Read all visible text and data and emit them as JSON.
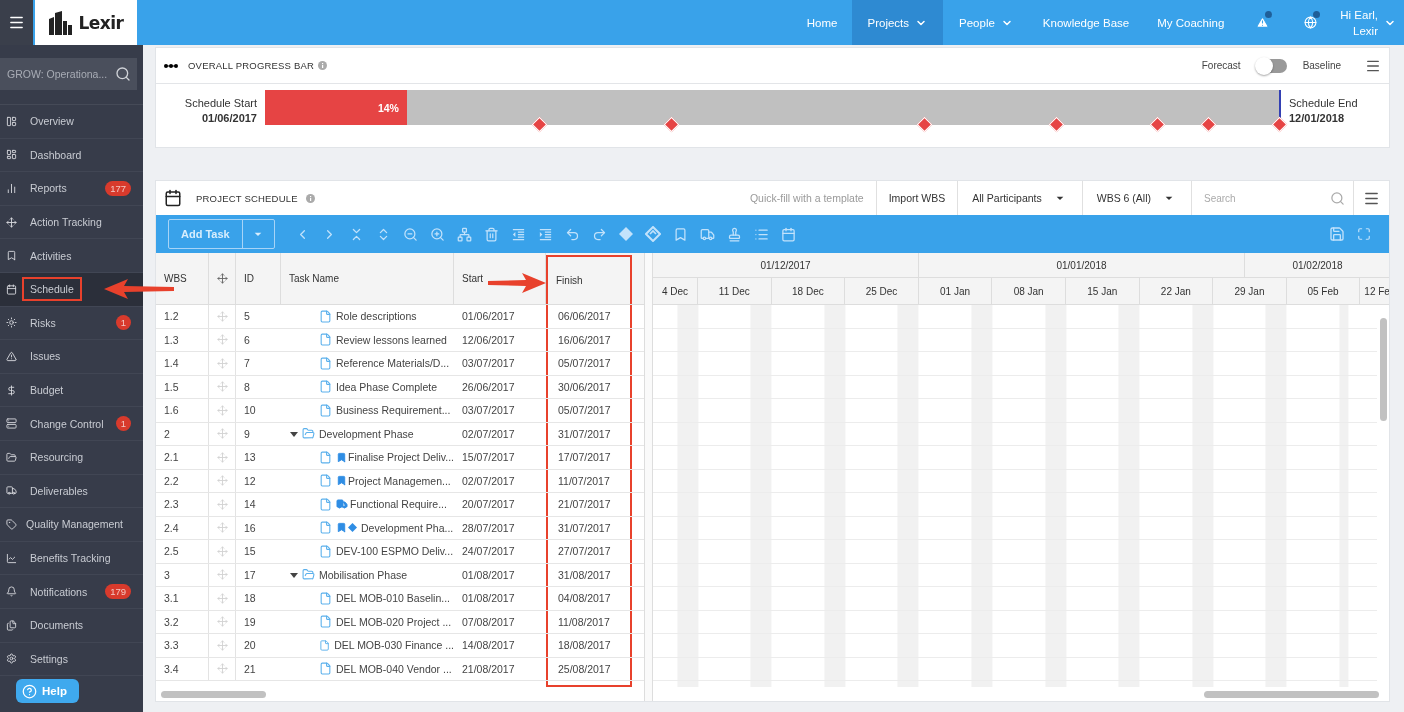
{
  "topbar": {
    "logo": "Lexir",
    "nav": [
      {
        "label": "Home",
        "selected": false,
        "dropdown": false
      },
      {
        "label": "Projects",
        "selected": true,
        "dropdown": true
      },
      {
        "label": "People",
        "selected": false,
        "dropdown": true
      },
      {
        "label": "Knowledge Base",
        "selected": false,
        "dropdown": false
      },
      {
        "label": "My Coaching",
        "selected": false,
        "dropdown": false
      }
    ],
    "alerts": [
      {
        "kind": "warning",
        "unread": true
      },
      {
        "kind": "globe",
        "unread": true
      }
    ],
    "user": {
      "greeting": "Hi Earl,",
      "org": "Lexir"
    }
  },
  "sidebar": {
    "project_search": {
      "value": "GROW: Operationa..."
    },
    "items": [
      {
        "label": "Overview",
        "selected": false,
        "highlighted": false
      },
      {
        "label": "Dashboard",
        "selected": false,
        "highlighted": false
      },
      {
        "label": "Reports",
        "badge": "177",
        "selected": false,
        "highlighted": false
      },
      {
        "label": "Action Tracking",
        "selected": false,
        "highlighted": false
      },
      {
        "label": "Activities",
        "selected": false,
        "highlighted": false
      },
      {
        "label": "Schedule",
        "selected": true,
        "highlighted": true
      },
      {
        "label": "Risks",
        "badge": "1",
        "selected": false,
        "highlighted": false
      },
      {
        "label": "Issues",
        "selected": false,
        "highlighted": false
      },
      {
        "label": "Budget",
        "selected": false,
        "highlighted": false
      },
      {
        "label": "Change Control",
        "badge": "1",
        "selected": false,
        "highlighted": false
      },
      {
        "label": "Resourcing",
        "selected": false,
        "highlighted": false
      },
      {
        "label": "Deliverables",
        "selected": false,
        "highlighted": false
      },
      {
        "label": "Quality Management",
        "selected": false,
        "highlighted": false
      },
      {
        "label": "Benefits Tracking",
        "selected": false,
        "highlighted": false
      },
      {
        "label": "Notifications",
        "badge": "179",
        "selected": false,
        "highlighted": false
      },
      {
        "label": "Documents",
        "selected": false,
        "highlighted": false
      },
      {
        "label": "Settings",
        "selected": false,
        "highlighted": false
      }
    ],
    "help": "Help"
  },
  "progress": {
    "title": "OVERALL PROGRESS BAR",
    "forecast_label": "Forecast",
    "baseline_label": "Baseline",
    "baseline_on": false,
    "start_label": "Schedule Start",
    "start_date": "01/06/2017",
    "end_label": "Schedule End",
    "end_date": "12/01/2018",
    "level": 0.14,
    "reading": "14%",
    "milestones": [
      {
        "level": 0.27
      },
      {
        "level": 0.4
      },
      {
        "level": 0.65
      },
      {
        "level": 0.78
      },
      {
        "level": 0.88
      },
      {
        "level": 0.93
      },
      {
        "level": 1.0
      }
    ]
  },
  "schedule": {
    "title": "PROJECT SCHEDULE",
    "quick_fill": "Quick-fill with a template",
    "import": "Import WBS",
    "participants": "All Participants",
    "wbs_filter": "WBS 6 (All)",
    "search": {
      "placeholder": "Search"
    },
    "add_task": "Add Task",
    "columns": [
      {
        "kind": "text",
        "label": "WBS",
        "highlighted": false
      },
      {
        "kind": "move",
        "highlighted": false
      },
      {
        "kind": "text",
        "label": "ID",
        "highlighted": false
      },
      {
        "kind": "text",
        "label": "Task Name",
        "highlighted": false
      },
      {
        "kind": "text",
        "label": "Start",
        "highlighted": false
      },
      {
        "kind": "text",
        "label": "Finish",
        "highlighted": true
      }
    ],
    "rows": [
      {
        "kind": "task",
        "wbs": "1.2",
        "id": "5",
        "name": "Role descriptions",
        "start": "01/06/2017",
        "finish": "06/06/2017",
        "bookmark": false,
        "truck": false,
        "milestone": false
      },
      {
        "kind": "task",
        "wbs": "1.3",
        "id": "6",
        "name": "Review lessons learned",
        "start": "12/06/2017",
        "finish": "16/06/2017",
        "bookmark": false,
        "truck": false,
        "milestone": false
      },
      {
        "kind": "task",
        "wbs": "1.4",
        "id": "7",
        "name": "Reference Materials/D...",
        "start": "03/07/2017",
        "finish": "05/07/2017",
        "bookmark": false,
        "truck": false,
        "milestone": false
      },
      {
        "kind": "task",
        "wbs": "1.5",
        "id": "8",
        "name": "Idea Phase Complete",
        "start": "26/06/2017",
        "finish": "30/06/2017",
        "bookmark": false,
        "truck": false,
        "milestone": false
      },
      {
        "kind": "task",
        "wbs": "1.6",
        "id": "10",
        "name": "Business Requirement...",
        "start": "03/07/2017",
        "finish": "05/07/2017",
        "bookmark": false,
        "truck": false,
        "milestone": false
      },
      {
        "kind": "phase",
        "wbs": "2",
        "id": "9",
        "name": "Development Phase",
        "start": "02/07/2017",
        "finish": "31/07/2017",
        "expanded": true,
        "children": [
          {
            "kind": "task",
            "wbs": "2.1",
            "id": "13",
            "name": "Finalise Project Deliv...",
            "start": "15/07/2017",
            "finish": "17/07/2017",
            "bookmark": true,
            "truck": false,
            "milestone": false
          },
          {
            "kind": "task",
            "wbs": "2.2",
            "id": "12",
            "name": "Project Managemen...",
            "start": "02/07/2017",
            "finish": "11/07/2017",
            "bookmark": true,
            "truck": false,
            "milestone": false
          },
          {
            "kind": "task",
            "wbs": "2.3",
            "id": "14",
            "name": "Functional Require...",
            "start": "20/07/2017",
            "finish": "21/07/2017",
            "bookmark": false,
            "truck": true,
            "milestone": false
          },
          {
            "kind": "task",
            "wbs": "2.4",
            "id": "16",
            "name": "Development Pha...",
            "start": "28/07/2017",
            "finish": "31/07/2017",
            "bookmark": true,
            "truck": false,
            "milestone": true
          },
          {
            "kind": "task",
            "wbs": "2.5",
            "id": "15",
            "name": "DEV-100 ESPMO Deliv...",
            "start": "24/07/2017",
            "finish": "27/07/2017",
            "bookmark": false,
            "truck": false,
            "milestone": false
          }
        ]
      },
      {
        "kind": "phase",
        "wbs": "3",
        "id": "17",
        "name": "Mobilisation Phase",
        "start": "01/08/2017",
        "finish": "31/08/2017",
        "expanded": true,
        "children": [
          {
            "kind": "task",
            "wbs": "3.1",
            "id": "18",
            "name": "DEL MOB-010 Baselin...",
            "start": "01/08/2017",
            "finish": "04/08/2017",
            "bookmark": false,
            "truck": false,
            "milestone": false
          },
          {
            "kind": "task",
            "wbs": "3.2",
            "id": "19",
            "name": "DEL MOB-020 Project ...",
            "start": "07/08/2017",
            "finish": "11/08/2017",
            "bookmark": false,
            "truck": false,
            "milestone": false
          },
          {
            "kind": "task",
            "wbs": "3.3",
            "id": "20",
            "name": "DEL MOB-030 Finance ...",
            "start": "14/08/2017",
            "finish": "18/08/2017",
            "bookmark": false,
            "truck": false,
            "milestone": false
          },
          {
            "kind": "task",
            "wbs": "3.4",
            "id": "21",
            "name": "DEL MOB-040 Vendor ...",
            "start": "21/08/2017",
            "finish": "25/08/2017",
            "bookmark": false,
            "truck": false,
            "milestone": false
          }
        ]
      }
    ],
    "timeline": {
      "months": [
        "01/12/2017",
        "01/01/2018",
        "01/02/2018"
      ],
      "weeks": [
        "4 Dec",
        "11 Dec",
        "18 Dec",
        "25 Dec",
        "01 Jan",
        "08 Jan",
        "15 Jan",
        "22 Jan",
        "29 Jan",
        "05 Feb",
        "12 Fe"
      ]
    }
  }
}
